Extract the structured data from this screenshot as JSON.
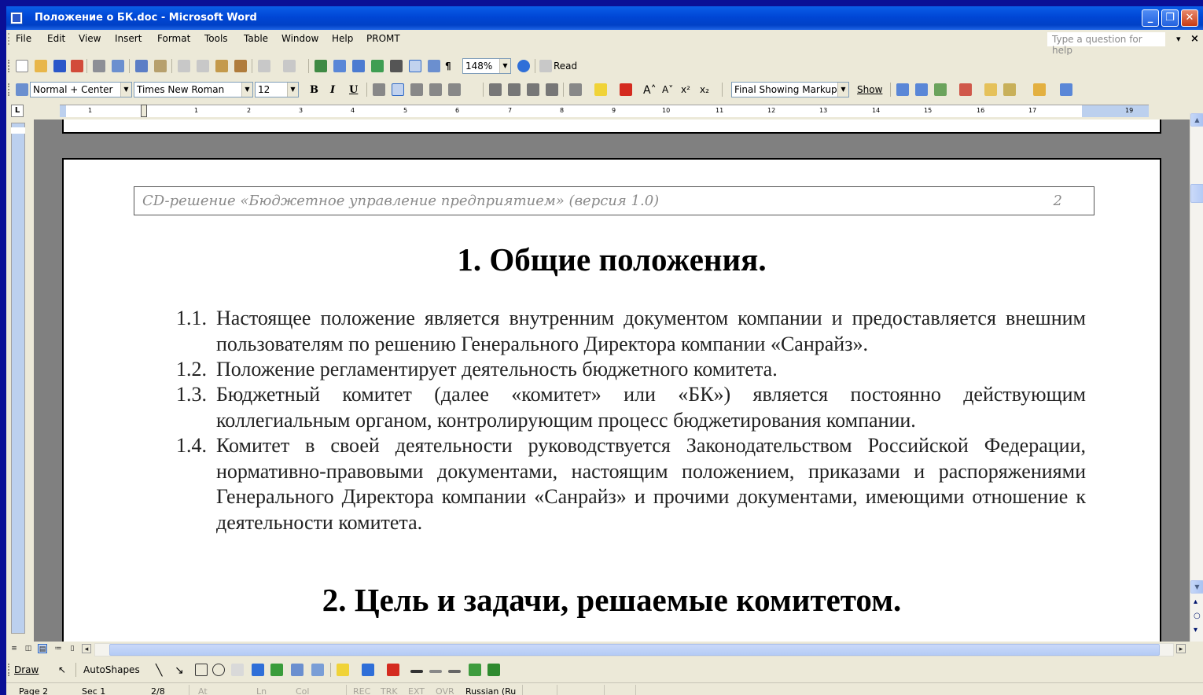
{
  "window": {
    "title": "Положение о БК.doc - Microsoft Word",
    "min_label": "_",
    "restore_label": "❐",
    "close_label": "✕"
  },
  "menu": {
    "items": [
      "File",
      "Edit",
      "View",
      "Insert",
      "Format",
      "Tools",
      "Table",
      "Window",
      "Help",
      "PROMT"
    ],
    "help_placeholder": "Type a question for help",
    "doc_close": "×"
  },
  "toolbar1": {
    "zoom": "148%",
    "read_label": "Read"
  },
  "toolbar2": {
    "style": "Normal + Center",
    "font": "Times New Roman",
    "size": "12",
    "bold": "B",
    "italic": "I",
    "underline": "U",
    "markup_mode": "Final Showing Markup",
    "show_label": "Show"
  },
  "ruler": {
    "box_label": "L",
    "numbers": [
      "1",
      "1",
      "2",
      "3",
      "4",
      "5",
      "6",
      "7",
      "8",
      "9",
      "10",
      "11",
      "12",
      "13",
      "14",
      "15",
      "16",
      "17",
      "19"
    ]
  },
  "document": {
    "header_text": "CD-решение «Бюджетное управление предприятием» (версия 1.0)",
    "header_page": "2",
    "heading1": "1. Общие положения.",
    "items": [
      {
        "num": "1.1.",
        "text": "Настоящее положение является внутренним документом компании и предоставляется внешним пользователям по решению Генерального Директора компании «Санрайз»."
      },
      {
        "num": "1.2.",
        "text": "Положение регламентирует деятельность бюджетного комитета."
      },
      {
        "num": "1.3.",
        "text": "Бюджетный комитет (далее «комитет» или «БК») является постоянно действующим коллегиальным органом, контролирующим процесс бюджетирования компании."
      },
      {
        "num": "1.4.",
        "text": "Комитет в своей деятельности руководствуется Законодательством Российской Федерации, нормативно-правовыми документами, настоящим положением, приказами и распоряжениями Генерального Директора компании «Санрайз» и прочими документами, имеющими отношение к деятельности комитета."
      }
    ],
    "heading2": "2. Цель и задачи, решаемые комитетом."
  },
  "drawbar": {
    "draw_label": "Draw",
    "autoshapes_label": "AutoShapes"
  },
  "status": {
    "page": "Page 2",
    "sec": "Sec 1",
    "pages": "2/8",
    "at": "At",
    "ln": "Ln",
    "col": "Col",
    "rec": "REC",
    "trk": "TRK",
    "ext": "EXT",
    "ovr": "OVR",
    "lang": "Russian (Ru"
  },
  "colors": {
    "desktop": "#0a0f96",
    "titlebar": "#0046d5",
    "chrome": "#ece9d8",
    "page_bg": "#ffffff",
    "doc_bg": "#808080",
    "header_text": "#8a8a8a"
  }
}
